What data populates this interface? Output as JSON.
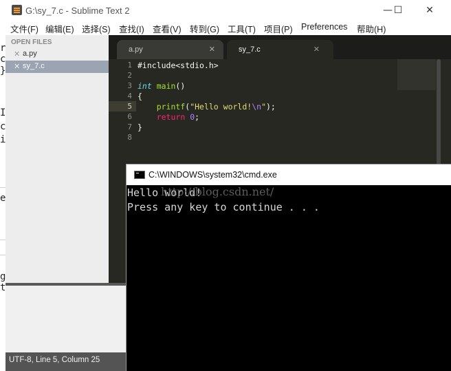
{
  "window": {
    "title": "G:\\sy_7.c - Sublime Text 2",
    "minimize": "—",
    "maximize": "☐",
    "close": "✕"
  },
  "menu": [
    "文件(F)",
    "编辑(E)",
    "选择(S)",
    "查找(I)",
    "查看(V)",
    "转到(G)",
    "工具(T)",
    "项目(P)",
    "Preferences",
    "帮助(H)"
  ],
  "sidebar": {
    "heading": "OPEN FILES",
    "files": [
      {
        "name": "a.py",
        "selected": false
      },
      {
        "name": "sy_7.c",
        "selected": true
      }
    ],
    "close_glyph": "✕"
  },
  "tabs": [
    {
      "label": "a.py",
      "active": false,
      "close": "✕"
    },
    {
      "label": "sy_7.c",
      "active": true,
      "close": "✕"
    }
  ],
  "editor": {
    "line_numbers": [
      "1",
      "2",
      "3",
      "4",
      "5",
      "6",
      "7",
      "8"
    ],
    "current_line": 5,
    "code": {
      "l1": "#include<stdio.h>",
      "l3_type": "int",
      "l3_fn": "main",
      "l3_rest": "()",
      "l4": "{",
      "l5_indent": "    ",
      "l5_fn": "printf",
      "l5_open": "(",
      "l5_str1": "\"Hello world!",
      "l5_esc": "\\n",
      "l5_str2": "\"",
      "l5_close": ");",
      "l6_indent": "    ",
      "l6_kw": "return",
      "l6_space": " ",
      "l6_num": "0",
      "l6_semi": ";",
      "l7": "}"
    },
    "theme_colors": {
      "background": "#272822",
      "keyword": "#f92672",
      "function": "#a6e22e",
      "string": "#e6db74",
      "type": "#66d9ef",
      "number": "#ae81ff"
    }
  },
  "statusbar": {
    "text": "UTF-8, Line 5, Column 25"
  },
  "cmd": {
    "title": "C:\\WINDOWS\\system32\\cmd.exe",
    "output": [
      "Hello world!",
      "Press any key to continue . . ."
    ],
    "watermark": "http://blog.csdn.net/"
  },
  "background_fragments": [
    "r",
    "c",
    "}",
    "I",
    "c",
    "i",
    "e",
    "g",
    "t",
    "e"
  ]
}
